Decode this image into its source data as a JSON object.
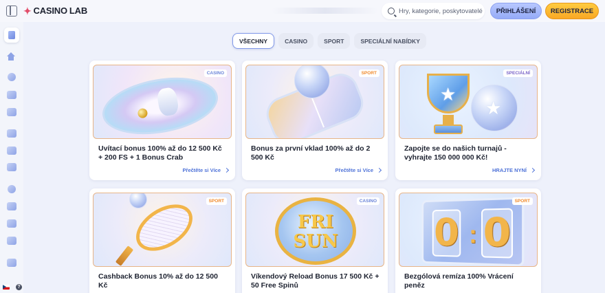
{
  "header": {
    "logo_star": "✦",
    "logo_main": "CASINO",
    "logo_suffix": "LAB",
    "search_placeholder": "Hry, kategorie, poskytovatelé",
    "login_label": "PŘIHLÁŠENÍ",
    "register_label": "REGISTRACE"
  },
  "sidebar": {
    "icons": [
      "promotions-icon",
      "home-icon",
      "casino-icon",
      "live-casino-icon",
      "slots-icon",
      "games-icon",
      "sports-icon",
      "esports-icon",
      "virtual-icon",
      "live-icon",
      "trophy-icon",
      "special-icon",
      "vip-icon",
      "crown-icon"
    ],
    "language_flag": "cz-flag",
    "help_label": "?"
  },
  "tabs": [
    {
      "label": "VŠECHNY",
      "active": true
    },
    {
      "label": "CASINO",
      "active": false
    },
    {
      "label": "SPORT",
      "active": false
    },
    {
      "label": "SPECIÁLNÍ NABÍDKY",
      "active": false
    }
  ],
  "cards": [
    {
      "badge": "CASINO",
      "title": "Uvítací bonus 100% až do 12 500 Kč + 200 FS + 1 Bonus Crab",
      "link": "Přečtěte si Více"
    },
    {
      "badge": "SPORT",
      "title": "Bonus za první vklad 100% až do 2 500 Kč",
      "link": "Přečtěte si Více"
    },
    {
      "badge": "SPECIÁLNÍ",
      "title": "Zapojte se do našich turnajů - vyhrajte 150 000 000 Kč!",
      "link": "HRAJTE NYNÍ"
    },
    {
      "badge": "SPORT",
      "title": "Cashback Bonus 10% až do 12 500 Kč",
      "link": ""
    },
    {
      "badge": "CASINO",
      "title": "Víkendový Reload Bonus 17 500 Kč + 50 Free Spinů",
      "link": ""
    },
    {
      "badge": "SPORT",
      "title": "Bezgólová remíza 100% Vrácení peněz",
      "link": ""
    }
  ],
  "artwork": {
    "weekend_coin_line1": "FRI",
    "weekend_coin_line2": "SUN",
    "score_left": "0",
    "score_right": "0",
    "score_sep": ":"
  },
  "colors": {
    "background": "#eef1fb",
    "accent_blue": "#4e72d8",
    "register_yellow": "#f9a825",
    "login_blue": "#95abf7",
    "badge_sport": "#f08a2c",
    "badge_casino": "#6a84d8"
  }
}
